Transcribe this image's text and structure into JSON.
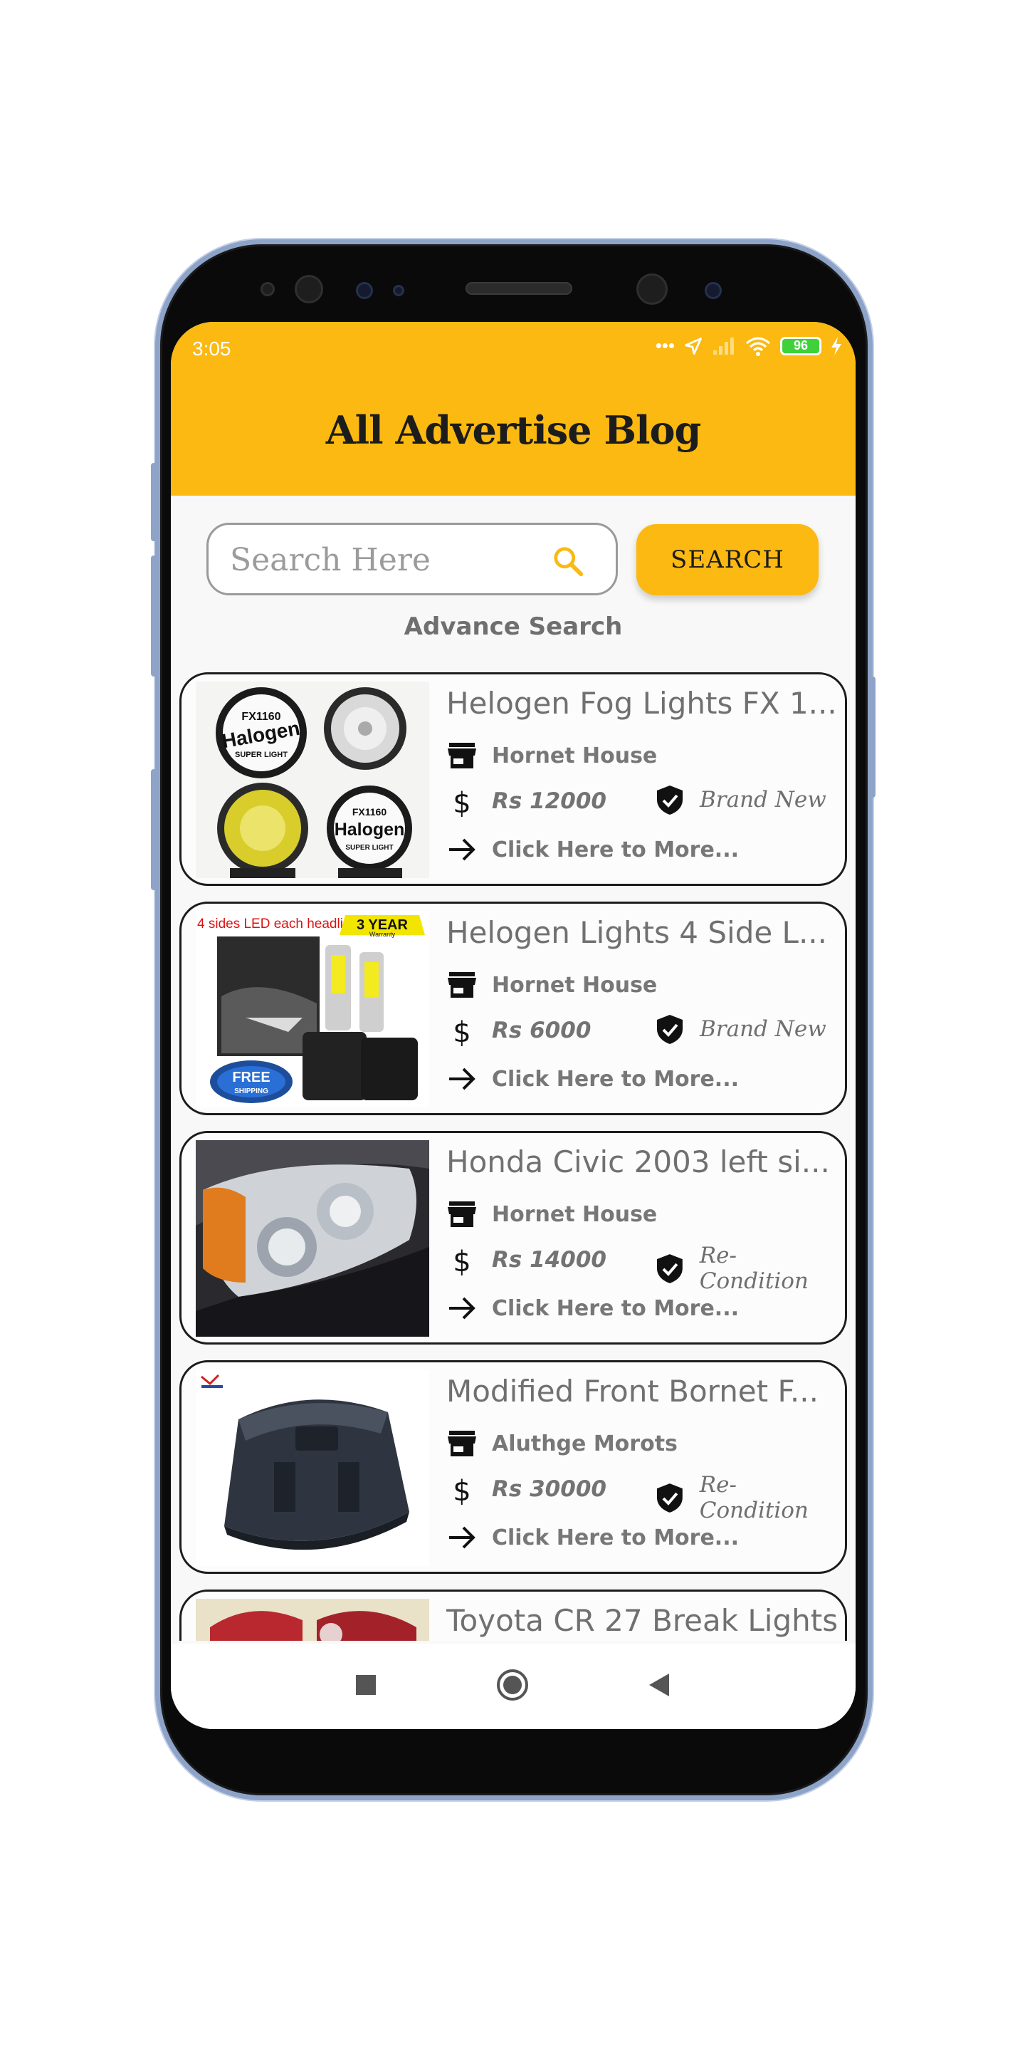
{
  "status_bar": {
    "time": "3:05",
    "icons": [
      "more-dots-icon",
      "location-arrow-icon",
      "signal-icon",
      "wifi-icon",
      "battery-icon",
      "charging-bolt-icon"
    ],
    "battery_level": "96"
  },
  "header": {
    "title": "All Advertise Blog",
    "background_color": "#fbb911"
  },
  "search": {
    "placeholder": "Search Here",
    "value": "",
    "button_label": "SEARCH",
    "advance_label": "Advance Search"
  },
  "ads": [
    {
      "title": "Helogen Fog Lights FX 1...",
      "shop": "Hornet House",
      "price": "Rs 12000",
      "condition": "Brand New",
      "more": "Click Here to More..."
    },
    {
      "title": "Helogen Lights 4 Side L...",
      "shop": "Hornet House",
      "price": "Rs 6000",
      "condition": "Brand New",
      "more": "Click Here to More..."
    },
    {
      "title": "Honda Civic 2003 left si...",
      "shop": "Hornet House",
      "price": "Rs 14000",
      "condition": "Re-Condition",
      "more": "Click Here to More..."
    },
    {
      "title": "Modified Front Bornet F...",
      "shop": "Aluthge Morots",
      "price": "Rs 30000",
      "condition": "Re-Condition",
      "more": "Click Here to More..."
    },
    {
      "title": "Toyota CR 27 Break Lights",
      "shop": "",
      "price": "",
      "condition": "",
      "more": ""
    }
  ],
  "thumb_text": {
    "ad1_label": "FX1160",
    "ad1_brand": "Halogen",
    "ad1_sub": "SUPER LIGHT",
    "ad2_banner": "4 sides LED each headlight",
    "ad2_warranty": "3 YEAR",
    "ad2_warranty_sub": "Warranty",
    "ad2_badge": "FREE",
    "ad2_badge_sub": "SHIPPING"
  },
  "navbar": {
    "buttons": [
      "square-recents-icon",
      "circle-home-icon",
      "triangle-back-icon"
    ]
  }
}
